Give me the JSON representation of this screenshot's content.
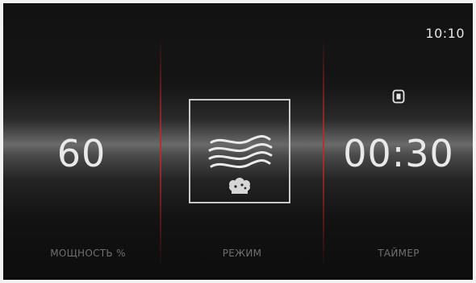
{
  "status_bar": {
    "time": "10:10"
  },
  "power": {
    "value": "60",
    "label": "МОЩНОСТЬ %"
  },
  "mode": {
    "label": "РЕЖИМ",
    "icon": "steam-heat-icon"
  },
  "timer": {
    "value": "00:30",
    "label": "ТАЙМЕР",
    "icon": "timer-lock-icon"
  },
  "colors": {
    "divider_accent": "#b42d2d",
    "text_primary": "#e9e9e9",
    "text_label": "#6f6f6f"
  }
}
